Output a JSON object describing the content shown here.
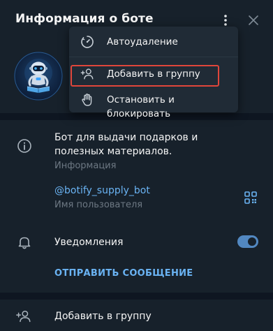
{
  "header": {
    "title": "Информация о боте",
    "more_icon": "more-vertical-icon",
    "close_icon": "close-icon"
  },
  "profile": {
    "avatar_icon": "robot-avatar"
  },
  "info": {
    "description": "Бот для выдачи подарков и полезных материалов.",
    "description_caption": "Информация",
    "username": "@botify_supply_bot",
    "username_caption": "Имя пользователя",
    "info_icon": "info-icon",
    "qr_icon": "qr-code-icon"
  },
  "notifications": {
    "label": "Уведомления",
    "enabled": true,
    "bell_icon": "bell-icon"
  },
  "send_message": {
    "label": "ОТПРАВИТЬ СООБЩЕНИЕ"
  },
  "add_to_group_row": {
    "label": "Добавить в группу",
    "icon": "add-user-icon"
  },
  "menu": {
    "items": [
      {
        "label": "Автоудаление",
        "icon": "timer-icon"
      },
      {
        "label": "Добавить в группу",
        "icon": "add-user-icon"
      },
      {
        "label": "Остановить и блокировать",
        "icon": "hand-stop-icon"
      }
    ]
  },
  "colors": {
    "panel_bg": "#17212b",
    "menu_bg": "#202b36",
    "accent": "#6ab3f3",
    "toggle": "#5288c1",
    "highlight": "#e0463b",
    "muted": "#6d7883"
  }
}
